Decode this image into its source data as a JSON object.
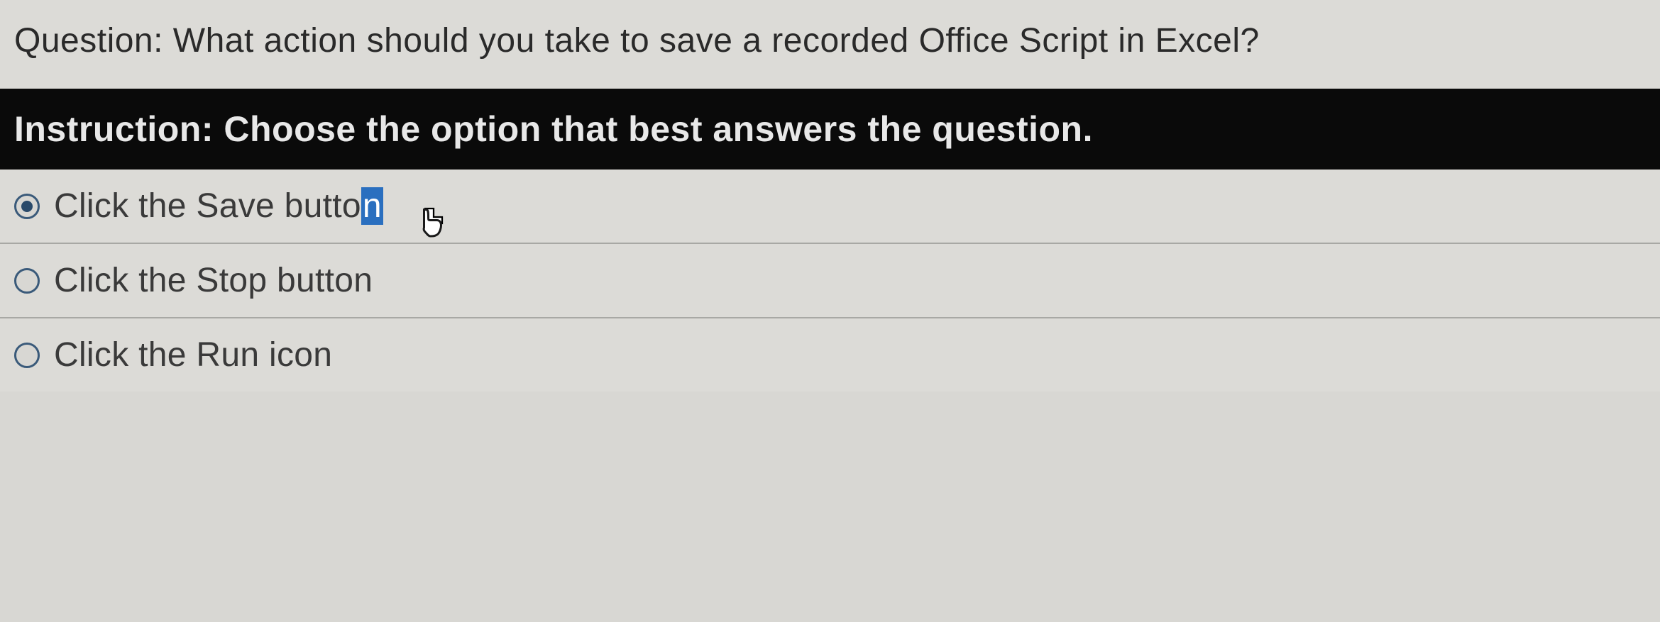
{
  "question": {
    "label": "Question:",
    "text": "What action should you take to save a recorded Office Script in Excel?"
  },
  "instruction": {
    "label": "Instruction:",
    "text": "Choose the option that best answers the question."
  },
  "options": [
    {
      "text_prefix": "Click the Save butto",
      "text_highlight": "n",
      "selected": true
    },
    {
      "text": "Click the Stop button",
      "selected": false
    },
    {
      "text": "Click the Run icon",
      "selected": false
    }
  ]
}
